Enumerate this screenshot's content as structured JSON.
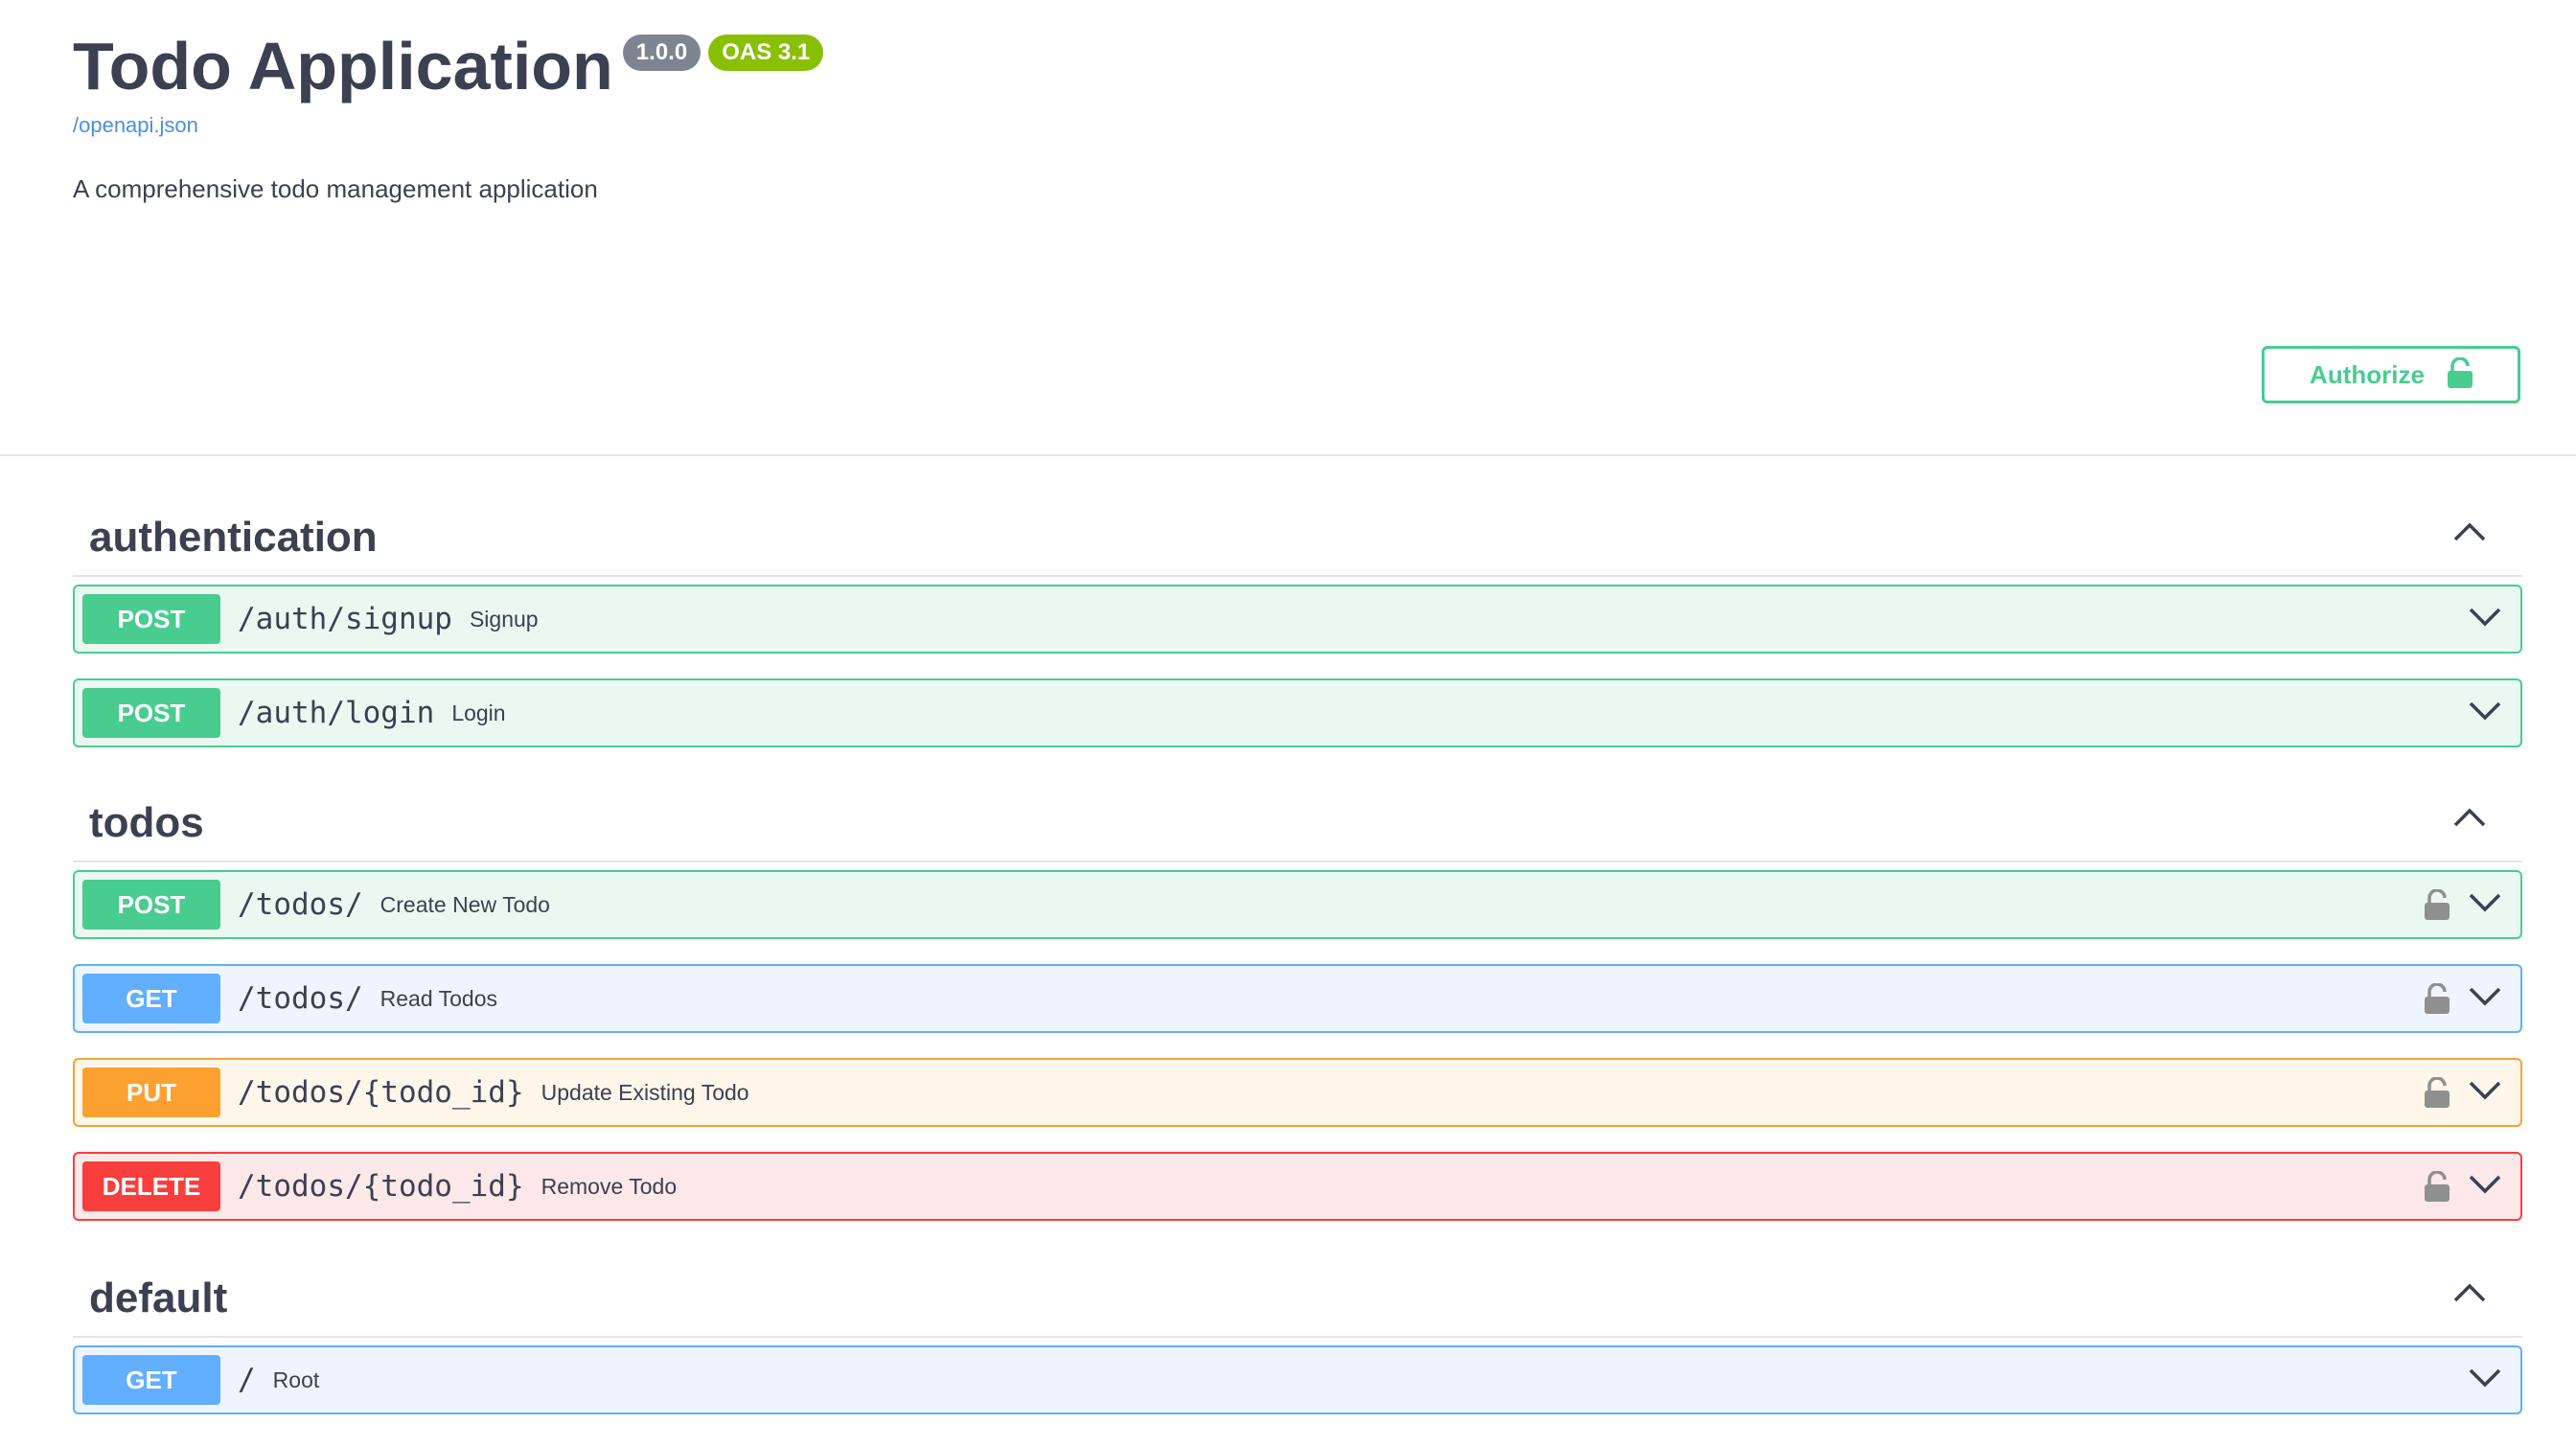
{
  "info": {
    "title": "Todo Application",
    "version": "1.0.0",
    "oas": "OAS 3.1",
    "spec_link": "/openapi.json",
    "description": "A comprehensive todo management application"
  },
  "authorize": {
    "label": "Authorize",
    "icon": "unlocked-padlock-icon",
    "color": "#49cc90"
  },
  "colors": {
    "post": "#49cc90",
    "get": "#61affe",
    "put": "#fca130",
    "delete": "#f93e3e",
    "text": "#3b4151",
    "link": "#4990e2"
  },
  "tags": [
    {
      "name": "authentication",
      "operations": [
        {
          "method": "POST",
          "path": "/auth/signup",
          "summary": "Signup"
        },
        {
          "method": "POST",
          "path": "/auth/login",
          "summary": "Login"
        }
      ]
    },
    {
      "name": "todos",
      "operations": [
        {
          "method": "POST",
          "path": "/todos/",
          "summary": "Create New Todo"
        },
        {
          "method": "GET",
          "path": "/todos/",
          "summary": "Read Todos"
        },
        {
          "method": "PUT",
          "path": "/todos/{todo_id}",
          "summary": "Update Existing Todo"
        },
        {
          "method": "DELETE",
          "path": "/todos/{todo_id}",
          "summary": "Remove Todo"
        }
      ]
    },
    {
      "name": "default",
      "operations": [
        {
          "method": "GET",
          "path": "/",
          "summary": "Root"
        }
      ]
    }
  ]
}
